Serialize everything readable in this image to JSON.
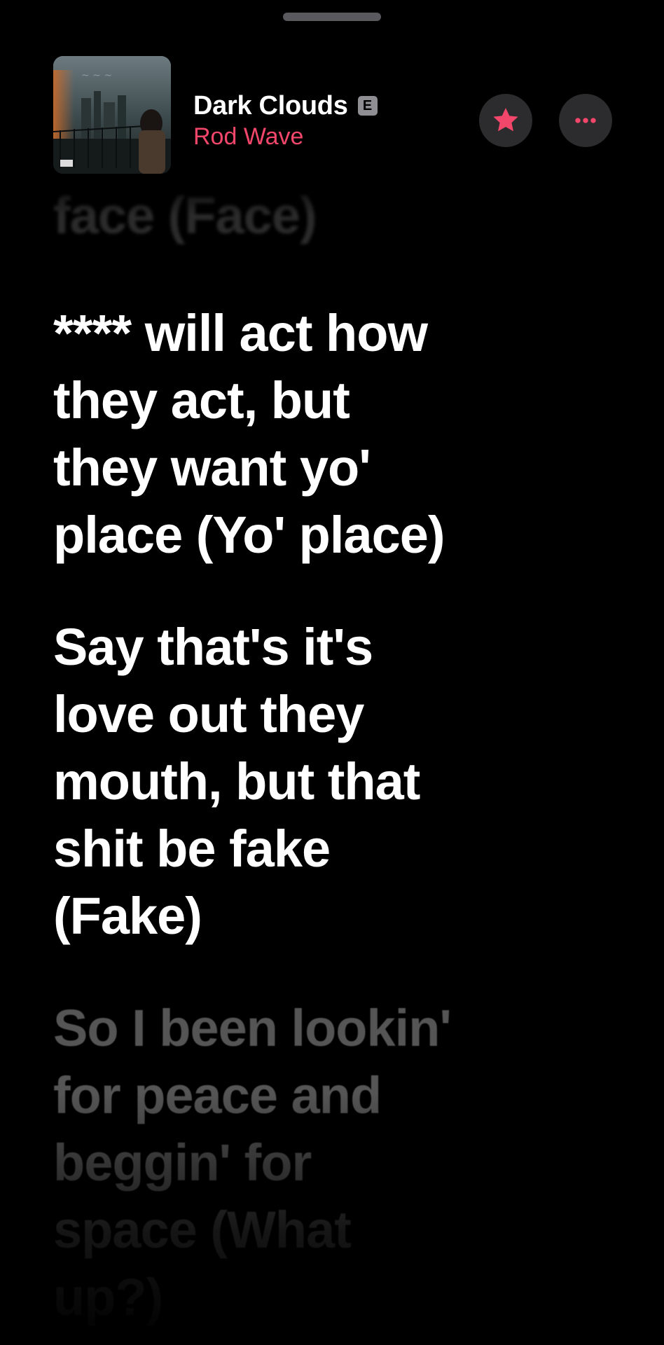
{
  "now_playing": {
    "title": "Dark Clouds",
    "explicit_badge": "E",
    "artist": "Rod Wave",
    "artwork_icon": "album-artwork",
    "favorite_icon": "star-icon",
    "more_icon": "ellipsis-icon"
  },
  "lyrics": {
    "previous": "face (Face)",
    "active_1": "**** will act how\nthey act, but\nthey want yo'\nplace (Yo' place)",
    "active_2": "Say that's it's\nlove out they\nmouth, but that\nshit be fake\n(Fake)",
    "next": "So I been lookin'\nfor peace and\nbeggin' for\nspace (What\nup?)"
  },
  "colors": {
    "background": "#000000",
    "accent": "#f2476b",
    "button_bg": "#2c2c2e",
    "active_text": "#ffffff",
    "inactive_text": "#555555"
  }
}
